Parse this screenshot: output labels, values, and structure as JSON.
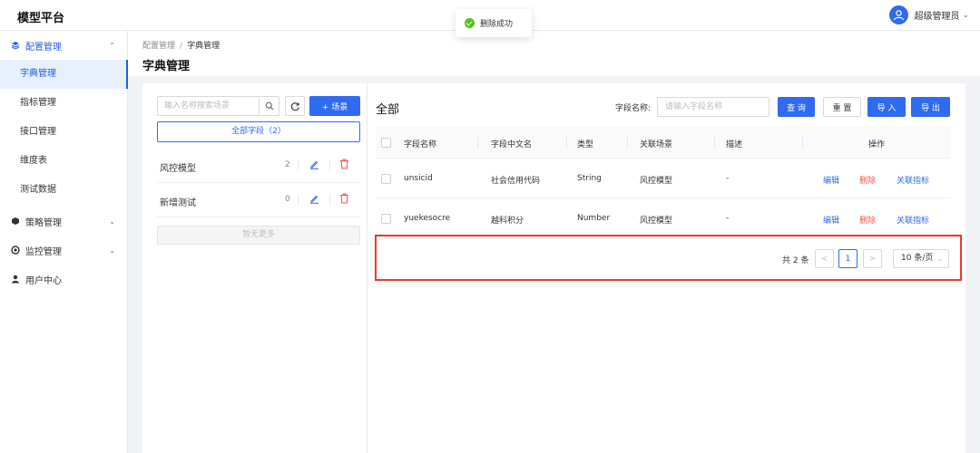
{
  "app": {
    "title": "模型平台"
  },
  "user": {
    "name": "超级管理员"
  },
  "toast": {
    "text": "删除成功"
  },
  "sidebar": {
    "groups": [
      {
        "label": "配置管理",
        "icon": "layers-icon",
        "expanded": true,
        "items": [
          {
            "label": "字典管理",
            "active": true
          },
          {
            "label": "指标管理"
          },
          {
            "label": "接口管理"
          },
          {
            "label": "维度表"
          },
          {
            "label": "测试数据"
          }
        ]
      },
      {
        "label": "策略管理",
        "icon": "cube-icon"
      },
      {
        "label": "监控管理",
        "icon": "monitor-icon"
      },
      {
        "label": "用户中心",
        "icon": "user-icon"
      }
    ]
  },
  "breadcrumb": {
    "parent": "配置管理",
    "separator": "/",
    "current": "字典管理"
  },
  "page": {
    "title": "字典管理"
  },
  "left_panel": {
    "search_placeholder": "输入名称搜索场景",
    "add_scene_label": "+ 场景",
    "all_fields_label": "全部字段（2）",
    "scenes": [
      {
        "name": "风控模型",
        "count": "2"
      },
      {
        "name": "新增测试",
        "count": "0"
      }
    ],
    "no_more_label": "暂无更多"
  },
  "right_panel": {
    "title": "全部",
    "filter_label": "字段名称:",
    "filter_placeholder": "请输入字段名称",
    "buttons": {
      "query": "查 询",
      "reset": "重 置",
      "import": "导 入",
      "export": "导 出"
    },
    "table": {
      "columns": [
        "字段名称",
        "字段中文名",
        "类型",
        "关联场景",
        "描述",
        "操作"
      ],
      "rows": [
        {
          "name": "unsicid",
          "cn_name": "社会信用代码",
          "type": "String",
          "scene": "风控模型",
          "desc": "-"
        },
        {
          "name": "yuekesocre",
          "cn_name": "越科积分",
          "type": "Number",
          "scene": "风控模型",
          "desc": "-"
        }
      ],
      "actions": {
        "edit": "编辑",
        "delete": "删除",
        "link": "关联指标"
      }
    },
    "pagination": {
      "total_text": "共 2 条",
      "current_page": "1",
      "prev": "<",
      "next": ">",
      "page_size": "10 条/页"
    }
  }
}
